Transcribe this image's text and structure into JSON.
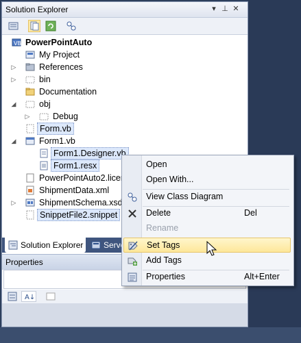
{
  "window": {
    "title": "Solution Explorer"
  },
  "tree": {
    "root": "PowerPointAuto",
    "items": [
      {
        "label": "My Project"
      },
      {
        "label": "References"
      },
      {
        "label": "bin"
      },
      {
        "label": "Documentation"
      },
      {
        "label": "obj"
      },
      {
        "label": "Debug"
      },
      {
        "label": "Form.vb"
      },
      {
        "label": "Form1.vb"
      },
      {
        "label": "Form1.Designer.vb"
      },
      {
        "label": "Form1.resx"
      },
      {
        "label": "PowerPointAuto2.licer"
      },
      {
        "label": "ShipmentData.xml"
      },
      {
        "label": "ShipmentSchema.xsd"
      },
      {
        "label": "SnippetFile2.snippet"
      }
    ]
  },
  "tabs": {
    "solution_explorer": "Solution Explorer",
    "server": "Serve"
  },
  "properties": {
    "title": "Properties"
  },
  "context_menu": {
    "items": [
      {
        "label": "Open",
        "shortcut": ""
      },
      {
        "label": "Open With...",
        "shortcut": ""
      },
      {
        "label": "View Class Diagram",
        "shortcut": ""
      },
      {
        "label": "Delete",
        "shortcut": "Del"
      },
      {
        "label": "Rename",
        "shortcut": ""
      },
      {
        "label": "Set Tags",
        "shortcut": ""
      },
      {
        "label": "Add Tags",
        "shortcut": ""
      },
      {
        "label": "Properties",
        "shortcut": "Alt+Enter"
      }
    ]
  },
  "colors": {
    "highlight": "#fde79a",
    "selection": "#dce8fb",
    "accent": "#3f557e"
  }
}
